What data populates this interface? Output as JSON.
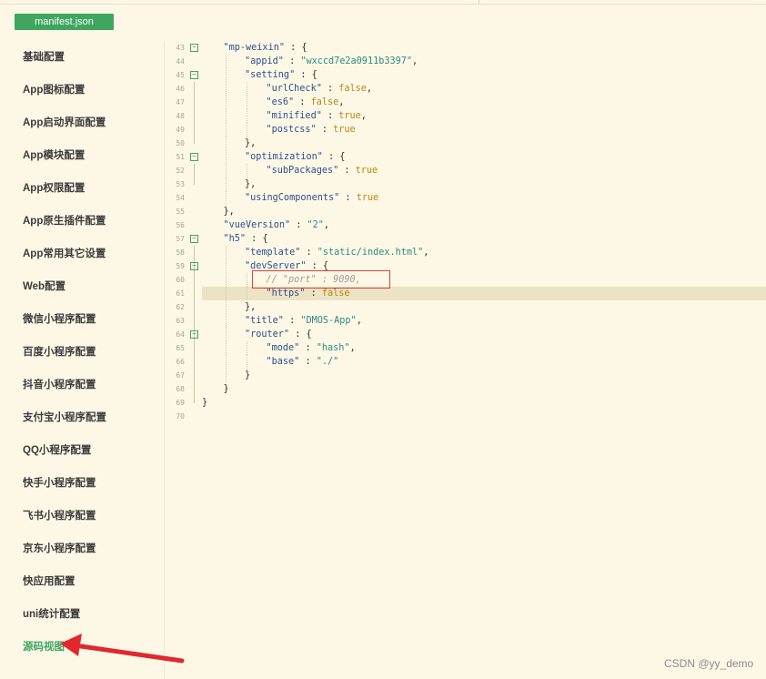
{
  "tab": {
    "label": "manifest.json"
  },
  "sidebar": {
    "items": [
      {
        "label": "基础配置"
      },
      {
        "label": "App图标配置"
      },
      {
        "label": "App启动界面配置"
      },
      {
        "label": "App模块配置"
      },
      {
        "label": "App权限配置"
      },
      {
        "label": "App原生插件配置"
      },
      {
        "label": "App常用其它设置"
      },
      {
        "label": "Web配置"
      },
      {
        "label": "微信小程序配置"
      },
      {
        "label": "百度小程序配置"
      },
      {
        "label": "抖音小程序配置"
      },
      {
        "label": "支付宝小程序配置"
      },
      {
        "label": "QQ小程序配置"
      },
      {
        "label": "快手小程序配置"
      },
      {
        "label": "飞书小程序配置"
      },
      {
        "label": "京东小程序配置"
      },
      {
        "label": "快应用配置"
      },
      {
        "label": "uni统计配置"
      },
      {
        "label": "源码视图",
        "active": true
      }
    ]
  },
  "editor": {
    "current_line": 61,
    "lines": [
      {
        "n": "43",
        "fold": true,
        "indent": 1,
        "t": [
          [
            "k",
            "\"mp-weixin\""
          ],
          [
            "p",
            " : {"
          ]
        ]
      },
      {
        "n": "44",
        "indent": 2,
        "t": [
          [
            "k",
            "\"appid\""
          ],
          [
            "p",
            " : "
          ],
          [
            "s",
            "\"wxccd7e2a0911b3397\""
          ],
          [
            "p",
            ","
          ]
        ]
      },
      {
        "n": "45",
        "fold": true,
        "indent": 2,
        "t": [
          [
            "k",
            "\"setting\""
          ],
          [
            "p",
            " : {"
          ]
        ]
      },
      {
        "n": "46",
        "indent": 3,
        "t": [
          [
            "k",
            "\"urlCheck\""
          ],
          [
            "p",
            " : "
          ],
          [
            "b",
            "false"
          ],
          [
            "p",
            ","
          ]
        ]
      },
      {
        "n": "47",
        "indent": 3,
        "t": [
          [
            "k",
            "\"es6\""
          ],
          [
            "p",
            " : "
          ],
          [
            "b",
            "false"
          ],
          [
            "p",
            ","
          ]
        ]
      },
      {
        "n": "48",
        "indent": 3,
        "t": [
          [
            "k",
            "\"minified\""
          ],
          [
            "p",
            " : "
          ],
          [
            "b",
            "true"
          ],
          [
            "p",
            ","
          ]
        ]
      },
      {
        "n": "49",
        "indent": 3,
        "t": [
          [
            "k",
            "\"postcss\""
          ],
          [
            "p",
            " : "
          ],
          [
            "b",
            "true"
          ]
        ]
      },
      {
        "n": "50",
        "indent": 2,
        "t": [
          [
            "p",
            "},"
          ]
        ]
      },
      {
        "n": "51",
        "fold": true,
        "indent": 2,
        "t": [
          [
            "k",
            "\"optimization\""
          ],
          [
            "p",
            " : {"
          ]
        ]
      },
      {
        "n": "52",
        "indent": 3,
        "t": [
          [
            "k",
            "\"subPackages\""
          ],
          [
            "p",
            " : "
          ],
          [
            "b",
            "true"
          ]
        ]
      },
      {
        "n": "53",
        "indent": 2,
        "t": [
          [
            "p",
            "},"
          ]
        ]
      },
      {
        "n": "54",
        "indent": 2,
        "t": [
          [
            "k",
            "\"usingComponents\""
          ],
          [
            "p",
            " : "
          ],
          [
            "b",
            "true"
          ]
        ]
      },
      {
        "n": "55",
        "indent": 1,
        "t": [
          [
            "p",
            "},"
          ]
        ]
      },
      {
        "n": "56",
        "indent": 1,
        "t": [
          [
            "k",
            "\"vueVersion\""
          ],
          [
            "p",
            " : "
          ],
          [
            "s",
            "\"2\""
          ],
          [
            "p",
            ","
          ]
        ]
      },
      {
        "n": "57",
        "fold": true,
        "indent": 1,
        "t": [
          [
            "k",
            "\"h5\""
          ],
          [
            "p",
            " : {"
          ]
        ]
      },
      {
        "n": "58",
        "indent": 2,
        "t": [
          [
            "k",
            "\"template\""
          ],
          [
            "p",
            " : "
          ],
          [
            "s",
            "\"static/index.html\""
          ],
          [
            "p",
            ","
          ]
        ]
      },
      {
        "n": "59",
        "fold": true,
        "indent": 2,
        "t": [
          [
            "k",
            "\"devServer\""
          ],
          [
            "p",
            " : {"
          ]
        ]
      },
      {
        "n": "60",
        "indent": 3,
        "t": [
          [
            "c",
            "// \"port\" : 9090,"
          ]
        ]
      },
      {
        "n": "61",
        "indent": 3,
        "t": [
          [
            "k",
            "\"https\""
          ],
          [
            "p",
            " : "
          ],
          [
            "b",
            "false"
          ]
        ]
      },
      {
        "n": "62",
        "indent": 2,
        "t": [
          [
            "p",
            "},"
          ]
        ]
      },
      {
        "n": "63",
        "indent": 2,
        "t": [
          [
            "k",
            "\"title\""
          ],
          [
            "p",
            " : "
          ],
          [
            "s",
            "\"DMOS-App\""
          ],
          [
            "p",
            ","
          ]
        ]
      },
      {
        "n": "64",
        "fold": true,
        "indent": 2,
        "t": [
          [
            "k",
            "\"router\""
          ],
          [
            "p",
            " : {"
          ]
        ]
      },
      {
        "n": "65",
        "indent": 3,
        "t": [
          [
            "k",
            "\"mode\""
          ],
          [
            "p",
            " : "
          ],
          [
            "s",
            "\"hash\""
          ],
          [
            "p",
            ","
          ]
        ]
      },
      {
        "n": "66",
        "indent": 3,
        "t": [
          [
            "k",
            "\"base\""
          ],
          [
            "p",
            " : "
          ],
          [
            "s",
            "\"./\""
          ]
        ]
      },
      {
        "n": "67",
        "indent": 2,
        "t": [
          [
            "p",
            "}"
          ]
        ]
      },
      {
        "n": "68",
        "indent": 1,
        "t": [
          [
            "p",
            "}"
          ]
        ]
      },
      {
        "n": "69",
        "indent": 0,
        "t": [
          [
            "p",
            "}"
          ]
        ]
      },
      {
        "n": "70",
        "indent": 0,
        "t": []
      }
    ]
  },
  "watermark": "CSDN @yy_demo",
  "colors": {
    "accent": "#3fa660",
    "arrow": "#e0282e",
    "highlight": "#d94040"
  }
}
